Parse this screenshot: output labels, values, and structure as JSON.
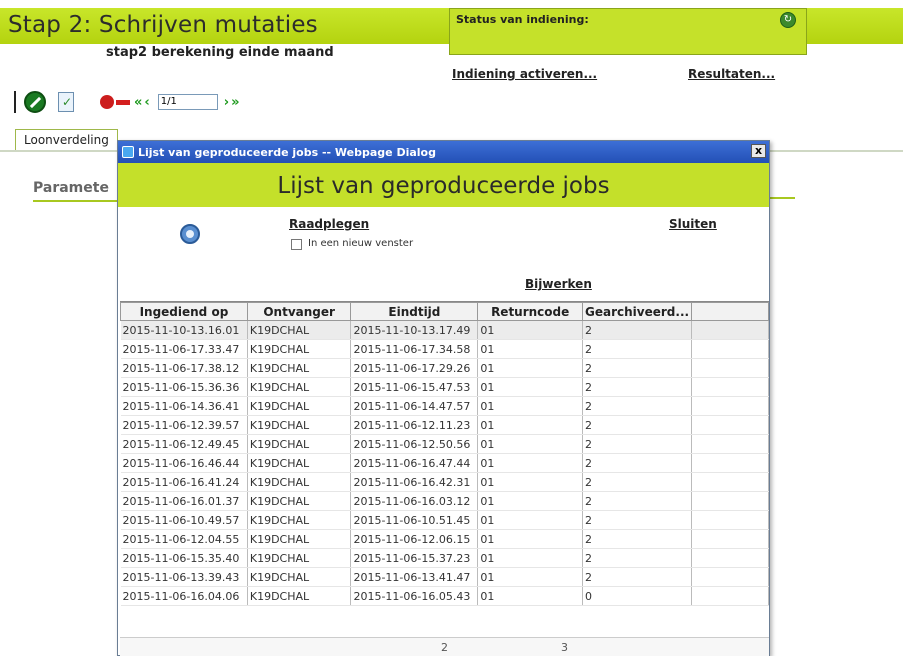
{
  "page": {
    "title": "Stap 2: Schrijven mutaties",
    "subtitle": "stap2 berekening einde maand",
    "status_label": "Status van indiening:",
    "link_activate": "Indiening activeren...",
    "link_results": "Resultaten...",
    "pager_text": "1/1",
    "tab_label": "Loonverdeling",
    "section_label": "Paramete"
  },
  "dialog": {
    "window_title": "Lijst van geproduceerde jobs -- Webpage Dialog",
    "close_glyph": "x",
    "heading": "Lijst van geproduceerde jobs",
    "link_view": "Raadplegen",
    "link_close": "Sluiten",
    "checkbox_label": "In een nieuw venster",
    "link_refresh": "Bijwerken",
    "columns": [
      "Ingediend op",
      "Ontvanger",
      "Eindtijd",
      "Returncode",
      "Gearchiveerd..."
    ],
    "rows": [
      [
        "2015-11-10-13.16.01",
        "K19DCHAL",
        "2015-11-10-13.17.49",
        "01",
        "2"
      ],
      [
        "2015-11-06-17.33.47",
        "K19DCHAL",
        "2015-11-06-17.34.58",
        "01",
        "2"
      ],
      [
        "2015-11-06-17.38.12",
        "K19DCHAL",
        "2015-11-06-17.29.26",
        "01",
        "2"
      ],
      [
        "2015-11-06-15.36.36",
        "K19DCHAL",
        "2015-11-06-15.47.53",
        "01",
        "2"
      ],
      [
        "2015-11-06-14.36.41",
        "K19DCHAL",
        "2015-11-06-14.47.57",
        "01",
        "2"
      ],
      [
        "2015-11-06-12.39.57",
        "K19DCHAL",
        "2015-11-06-12.11.23",
        "01",
        "2"
      ],
      [
        "2015-11-06-12.49.45",
        "K19DCHAL",
        "2015-11-06-12.50.56",
        "01",
        "2"
      ],
      [
        "2015-11-06-16.46.44",
        "K19DCHAL",
        "2015-11-06-16.47.44",
        "01",
        "2"
      ],
      [
        "2015-11-06-16.41.24",
        "K19DCHAL",
        "2015-11-06-16.42.31",
        "01",
        "2"
      ],
      [
        "2015-11-06-16.01.37",
        "K19DCHAL",
        "2015-11-06-16.03.12",
        "01",
        "2"
      ],
      [
        "2015-11-06-10.49.57",
        "K19DCHAL",
        "2015-11-06-10.51.45",
        "01",
        "2"
      ],
      [
        "2015-11-06-12.04.55",
        "K19DCHAL",
        "2015-11-06-12.06.15",
        "01",
        "2"
      ],
      [
        "2015-11-06-15.35.40",
        "K19DCHAL",
        "2015-11-06-15.37.23",
        "01",
        "2"
      ],
      [
        "2015-11-06-13.39.43",
        "K19DCHAL",
        "2015-11-06-13.41.47",
        "01",
        "2"
      ],
      [
        "2015-11-06-16.04.06",
        "K19DCHAL",
        "2015-11-06-16.05.43",
        "01",
        "0"
      ]
    ],
    "pager": [
      "2",
      "3"
    ]
  },
  "icons": {
    "status": "refresh-icon",
    "edit": "edit-icon",
    "approve": "approve-document-icon",
    "save": "save-disk-icon"
  },
  "colors": {
    "accent_green": "#c4e02a",
    "titlebar_blue": "#2350b6"
  }
}
